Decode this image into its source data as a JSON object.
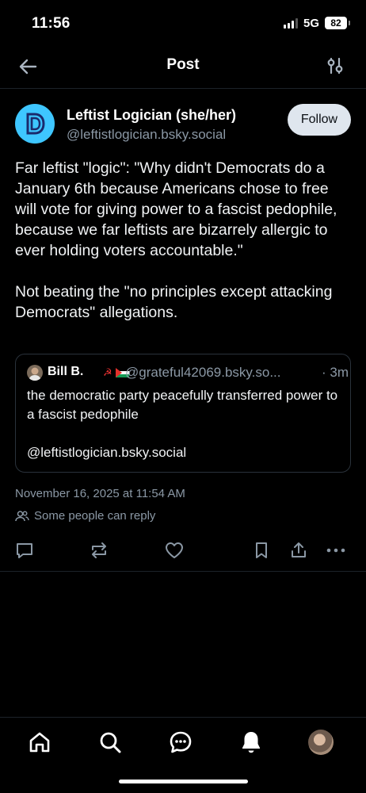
{
  "status_bar": {
    "time": "11:56",
    "network": "5G",
    "battery": "82"
  },
  "header": {
    "title": "Post",
    "back_icon": "arrow-left-icon",
    "filter_icon": "sliders-icon"
  },
  "post": {
    "author": {
      "display_name": "Leftist Logician (she/her)",
      "handle": "@leftistlogician.bsky.social",
      "avatar_letter": "D",
      "avatar_color": "#3ec6ff"
    },
    "follow_label": "Follow",
    "text_paragraphs": [
      "Far leftist \"logic\": \"Why didn't Democrats do a January 6th because Americans chose to free will vote for giving power to a fascist pedophile, because we far leftists are bizarrely allergic to ever holding voters accountable.\"",
      "Not beating the \"no principles except attacking Democrats\" allegations."
    ],
    "quote": {
      "display_name": "Bill B.",
      "emoji": "☭",
      "handle": "@grateful42069.bsky.so...",
      "time": "· 3m",
      "text_paragraphs": [
        "the democratic party peacefully transferred power to a fascist pedophile",
        "@leftistlogician.bsky.social"
      ]
    },
    "date": "November 16, 2025 at 11:54 AM",
    "reply_setting": "Some people can reply",
    "actions": [
      "reply-icon",
      "repost-icon",
      "like-icon",
      "bookmark-icon",
      "share-icon",
      "more-icon"
    ]
  },
  "bottom_nav": [
    "home-icon",
    "search-icon",
    "chat-icon",
    "notifications-icon",
    "profile-avatar"
  ],
  "colors": {
    "background": "#000000",
    "muted_text": "#8b98a5",
    "border": "#1c2229",
    "follow_bg": "#dfe6ee"
  }
}
